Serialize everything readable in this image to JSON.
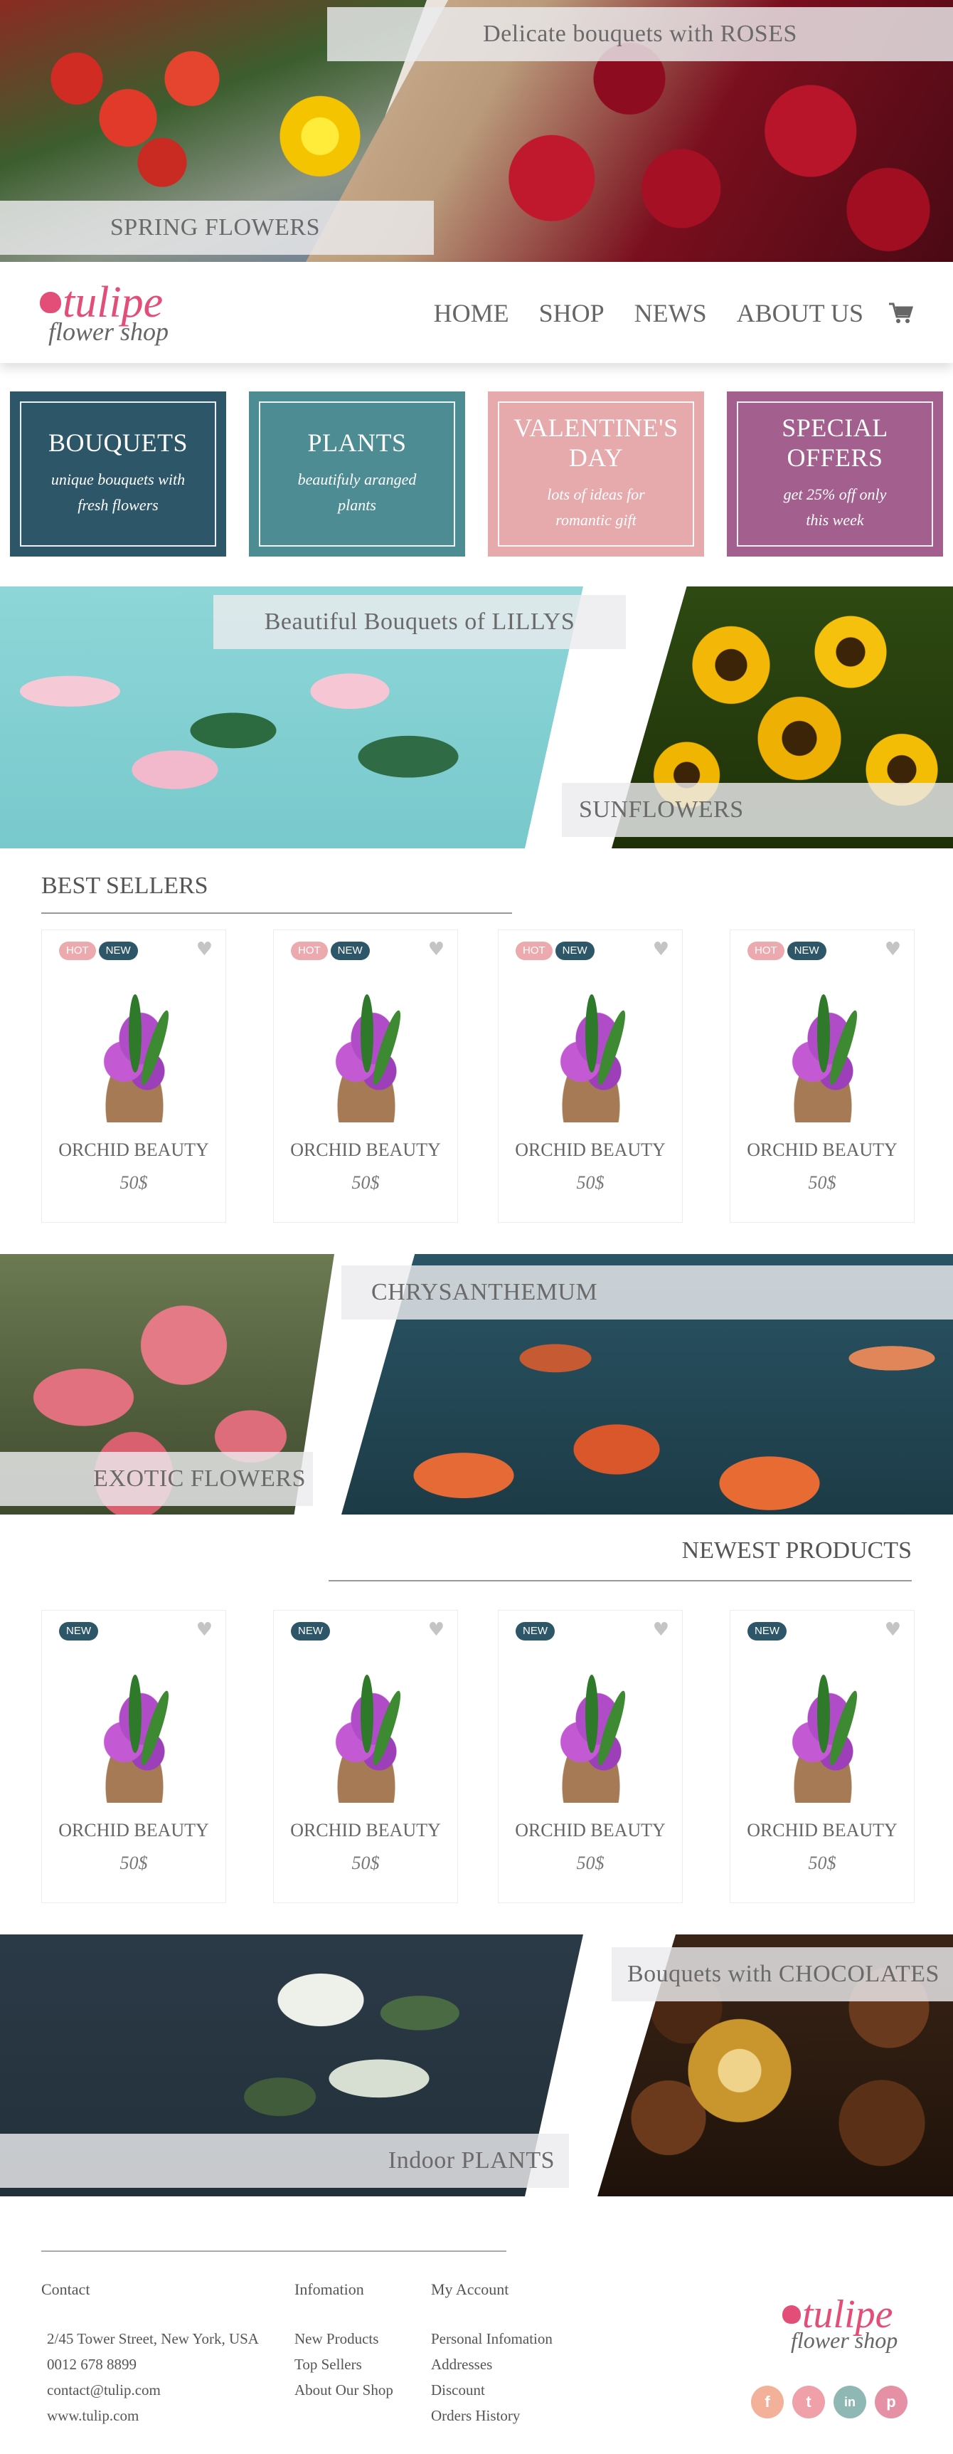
{
  "hero": {
    "top_band": "Delicate bouquets with ROSES",
    "bottom_band": "SPRING FLOWERS"
  },
  "header": {
    "logo_word": "tulipe",
    "logo_sub": "flower shop",
    "nav": [
      "HOME",
      "SHOP",
      "NEWS",
      "ABOUT US"
    ],
    "cart_icon": "cart-icon"
  },
  "categories": [
    {
      "title": "BOUQUETS",
      "line1": "unique bouquets with",
      "line2": "fresh flowers",
      "color": "#2d5669"
    },
    {
      "title": "PLANTS",
      "line1": "beautifuly aranged",
      "line2": "plants",
      "color": "#4e8c94"
    },
    {
      "title": "VALENTINE'S DAY",
      "line1": "lots of ideas for",
      "line2": "romantic gift",
      "color": "#e6a9ac"
    },
    {
      "title": "SPECIAL OFFERS",
      "line1": "get 25% off only",
      "line2": "this week",
      "color": "#a35f8d"
    }
  ],
  "banner2": {
    "left_band": "Beautiful Bouquets of LILLYS",
    "right_band": "SUNFLOWERS"
  },
  "best_sellers": {
    "title": "BEST SELLERS",
    "products": [
      {
        "name": "ORCHID BEAUTY",
        "price": "50$",
        "hot": "HOT",
        "new": "NEW"
      },
      {
        "name": "ORCHID BEAUTY",
        "price": "50$",
        "hot": "HOT",
        "new": "NEW"
      },
      {
        "name": "ORCHID BEAUTY",
        "price": "50$",
        "hot": "HOT",
        "new": "NEW"
      },
      {
        "name": "ORCHID BEAUTY",
        "price": "50$",
        "hot": "HOT",
        "new": "NEW"
      }
    ]
  },
  "banner3": {
    "left_band": "EXOTIC FLOWERS",
    "right_band": "CHRYSANTHEMUM"
  },
  "newest": {
    "title": "NEWEST PRODUCTS",
    "products": [
      {
        "name": "ORCHID BEAUTY",
        "price": "50$",
        "new": "NEW"
      },
      {
        "name": "ORCHID BEAUTY",
        "price": "50$",
        "new": "NEW"
      },
      {
        "name": "ORCHID BEAUTY",
        "price": "50$",
        "new": "NEW"
      },
      {
        "name": "ORCHID BEAUTY",
        "price": "50$",
        "new": "NEW"
      }
    ]
  },
  "banner4": {
    "left_band": "Indoor PLANTS",
    "right_band": "Bouquets with CHOCOLATES"
  },
  "footer": {
    "contact": {
      "title": "Contact",
      "items": [
        "2/45 Tower Street, New York, USA",
        "0012 678 8899",
        "contact@tulip.com",
        "www.tulip.com"
      ]
    },
    "information": {
      "title": "Infomation",
      "items": [
        "New Products",
        "Top Sellers",
        "About Our Shop"
      ]
    },
    "account": {
      "title": "My Account",
      "items": [
        "Personal Infomation",
        "Addresses",
        "Discount",
        "Orders History"
      ]
    },
    "social": [
      {
        "icon": "facebook-icon",
        "glyph": "f",
        "color": "#f3b199"
      },
      {
        "icon": "twitter-icon",
        "glyph": "t",
        "color": "#f0a0a8"
      },
      {
        "icon": "linkedin-icon",
        "glyph": "in",
        "color": "#8fb8b4"
      },
      {
        "icon": "pinterest-icon",
        "glyph": "p",
        "color": "#e590a5"
      }
    ]
  }
}
